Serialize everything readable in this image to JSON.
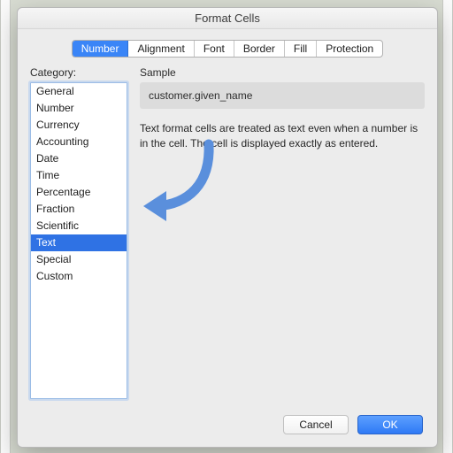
{
  "window": {
    "title": "Format Cells"
  },
  "tabs": [
    "Number",
    "Alignment",
    "Font",
    "Border",
    "Fill",
    "Protection"
  ],
  "active_tab_index": 0,
  "category": {
    "label": "Category:",
    "items": [
      "General",
      "Number",
      "Currency",
      "Accounting",
      "Date",
      "Time",
      "Percentage",
      "Fraction",
      "Scientific",
      "Text",
      "Special",
      "Custom"
    ],
    "selected_index": 9
  },
  "sample": {
    "label": "Sample",
    "value": "customer.given_name"
  },
  "description": "Text format cells are treated as text even when a number is in the cell.  The cell is displayed exactly as entered.",
  "buttons": {
    "cancel": "Cancel",
    "ok": "OK"
  },
  "colors": {
    "accent": "#2f72e4"
  }
}
